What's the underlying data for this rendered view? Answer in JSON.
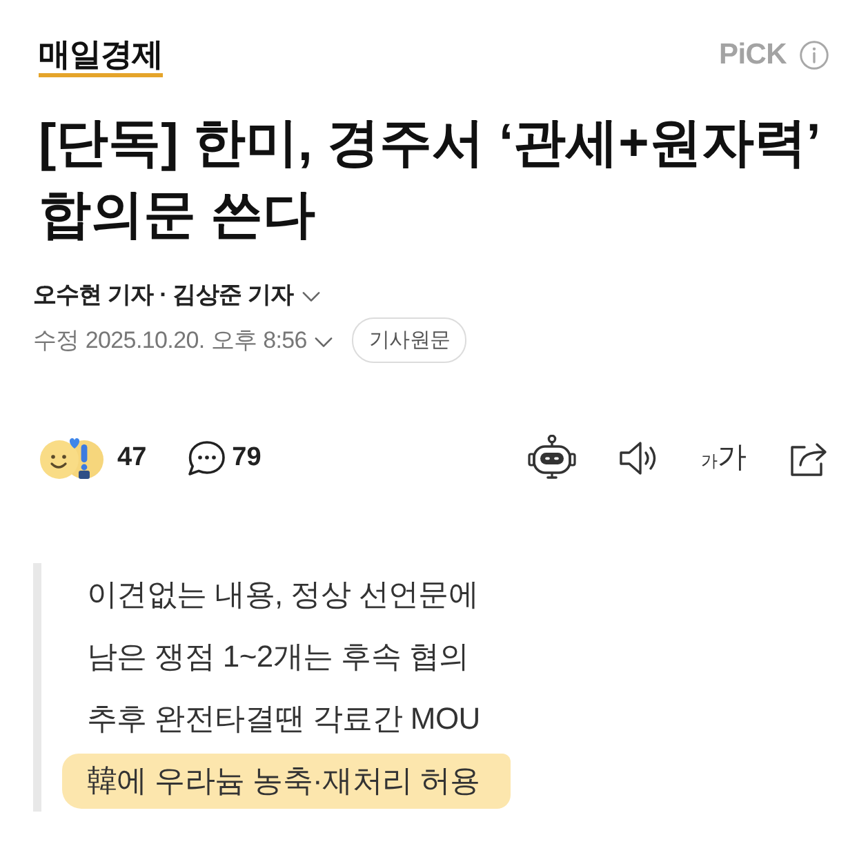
{
  "header": {
    "logo": "매일경제",
    "pick_label": "PiCK"
  },
  "headline": {
    "lines": [
      "[단독] 한미, 경주서 ‘관세+원자력’",
      "합의문 쓴다"
    ]
  },
  "byline": {
    "authors": "오수현 기자 · 김상준 기자",
    "modified": "수정 2025.10.20. 오후 8:56",
    "original_link": "기사원문"
  },
  "toolbar": {
    "reactions": "47",
    "comments": "79",
    "font_size": {
      "small": "가",
      "large": "가"
    }
  },
  "summary": {
    "lines": [
      {
        "text": "이견없는 내용, 정상 선언문에",
        "highlighted": false
      },
      {
        "text": "남은 쟁점 1~2개는 후속 협의",
        "highlighted": false
      },
      {
        "text": "추후 완전타결땐 각료간 MOU",
        "highlighted": false
      },
      {
        "text": "韓에 우라늄 농축·재처리 허용",
        "highlighted": true
      }
    ]
  }
}
